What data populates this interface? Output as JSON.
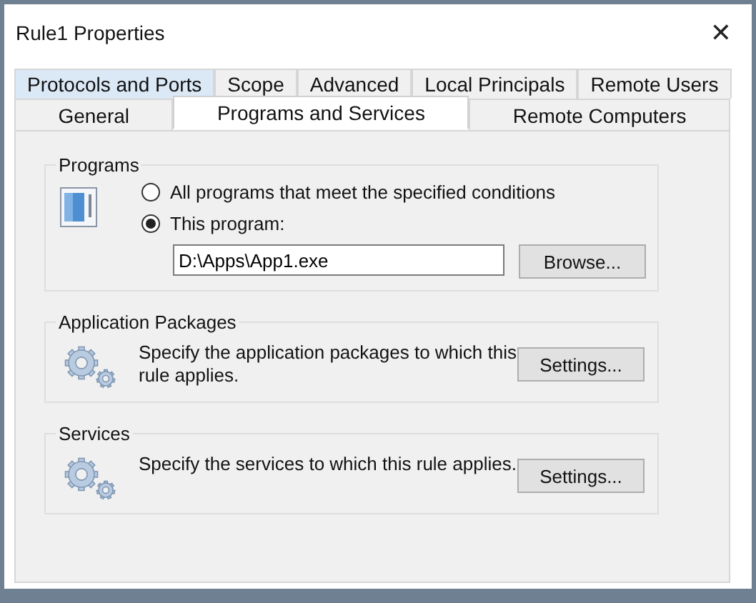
{
  "window": {
    "title": "Rule1 Properties",
    "close": "✕"
  },
  "tab_rows": [
    {
      "tabs": [
        {
          "label": "Protocols and Ports",
          "selected": false,
          "hovered": true
        },
        {
          "label": "Scope",
          "selected": false,
          "hovered": false
        },
        {
          "label": "Advanced",
          "selected": false,
          "hovered": false
        },
        {
          "label": "Local Principals",
          "selected": false,
          "hovered": false
        },
        {
          "label": "Remote Users",
          "selected": false,
          "hovered": false
        }
      ]
    },
    {
      "tabs": [
        {
          "label": "General",
          "selected": false,
          "hovered": false
        },
        {
          "label": "Programs and Services",
          "selected": true,
          "hovered": false
        },
        {
          "label": "Remote Computers",
          "selected": false,
          "hovered": false
        }
      ]
    }
  ],
  "groups": [
    {
      "kind": "programs",
      "title": "Programs",
      "options": [
        {
          "label": "All programs that meet the specified conditions",
          "selected": false
        },
        {
          "label": "This program:",
          "selected": true
        }
      ],
      "path": "D:\\Apps\\App1.exe",
      "button": "Browse..."
    },
    {
      "kind": "settings",
      "title": "Application Packages",
      "description": "Specify the application packages to which this rule applies.",
      "button": "Settings..."
    },
    {
      "kind": "settings",
      "title": "Services",
      "description": "Specify the services to which this rule applies.",
      "button": "Settings..."
    }
  ]
}
